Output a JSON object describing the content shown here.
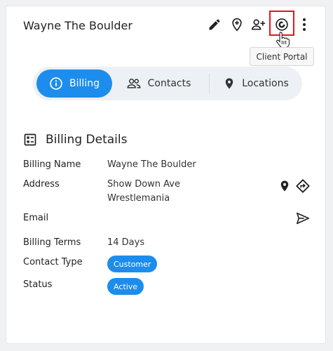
{
  "header": {
    "title": "Wayne The Boulder",
    "tooltip": "Client Portal",
    "icons": [
      "pencil-icon",
      "add-location-icon",
      "add-person-icon",
      "client-portal-icon",
      "more-vertical-icon"
    ]
  },
  "tabs": [
    {
      "label": "Billing",
      "icon": "info-icon",
      "active": true
    },
    {
      "label": "Contacts",
      "icon": "people-icon",
      "active": false
    },
    {
      "label": "Locations",
      "icon": "location-pin-icon",
      "active": false
    }
  ],
  "billing": {
    "section_title": "Billing Details",
    "name_label": "Billing Name",
    "name_value": "Wayne The Boulder",
    "address_label": "Address",
    "address_line1": "Show Down Ave",
    "address_line2": "Wrestlemania",
    "email_label": "Email",
    "terms_label": "Billing Terms",
    "terms_value": "14 Days",
    "contact_type_label": "Contact Type",
    "contact_type_value": "Customer",
    "status_label": "Status",
    "status_value": "Active"
  },
  "colors": {
    "accent": "#1d8ded",
    "highlight": "#e8141c",
    "tab_bg": "#edf0f4"
  }
}
